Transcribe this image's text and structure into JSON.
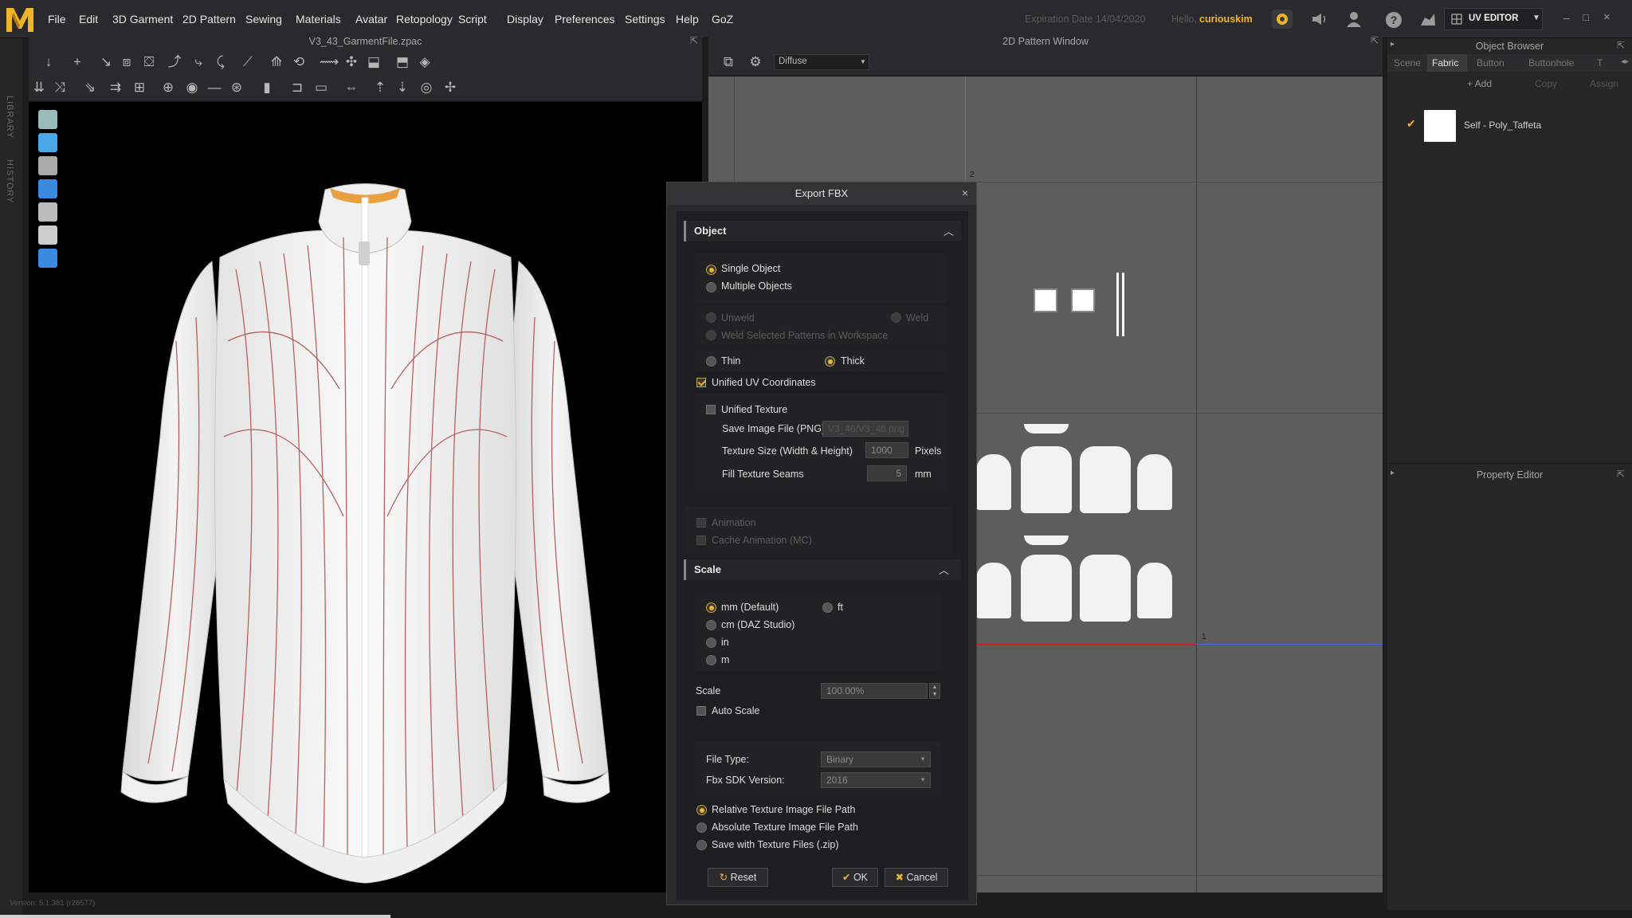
{
  "menubar": {
    "logo_letter": "M",
    "items": [
      "File",
      "Edit",
      "3D Garment",
      "2D Pattern",
      "Sewing",
      "Materials",
      "Avatar",
      "Retopology",
      "Script",
      "Display",
      "Preferences",
      "Settings",
      "Help",
      "GoZ"
    ],
    "expiration_label": "Expiration Date 14/04/2020",
    "hello_label": "Hello,",
    "username": "curiouskim",
    "mode": "UV EDITOR"
  },
  "left_tabs": [
    "LIBRARY",
    "HISTORY"
  ],
  "viewport3d": {
    "title": "V3_43_GarmentFile.zpac",
    "version": "Version: 5.1.381 (r28577)"
  },
  "pattern_window": {
    "title": "2D Pattern Window",
    "render_mode": "Diffuse",
    "marker_top": "2",
    "marker_bottom": "1"
  },
  "object_browser": {
    "title": "Object Browser",
    "tabs": [
      "Scene",
      "Fabric",
      "Button",
      "Buttonhole",
      "T"
    ],
    "active_tab": "Fabric",
    "actions": [
      "+ Add",
      "Copy",
      "Assign"
    ],
    "fabric_item": "Self - Poly_Taffeta"
  },
  "property_editor": {
    "title": "Property Editor"
  },
  "dialog": {
    "title": "Export FBX",
    "close_icon": "×",
    "object_section": "Object",
    "single_object": "Single Object",
    "multiple_objects": "Multiple Objects",
    "unweld": "Unweld",
    "weld": "Weld",
    "weld_selected": "Weld Selected Patterns in Workspace",
    "thin": "Thin",
    "thick": "Thick",
    "unified_uv": "Unified UV Coordinates",
    "unified_texture": "Unified Texture",
    "save_image_label": "Save Image File (PNG)",
    "save_image_value": "V3_46/V3_46.png",
    "texture_size_label": "Texture Size (Width & Height)",
    "texture_size_value": "1000",
    "texture_size_unit": "Pixels",
    "fill_seams_label": "Fill Texture Seams",
    "fill_seams_value": "5",
    "fill_seams_unit": "mm",
    "animation": "Animation",
    "cache_animation": "Cache Animation (MC)",
    "scale_section": "Scale",
    "unit_mm": "mm (Default)",
    "unit_ft": "ft",
    "unit_cm": "cm (DAZ Studio)",
    "unit_in": "in",
    "unit_m": "m",
    "scale_label": "Scale",
    "scale_value": "100.00%",
    "auto_scale": "Auto Scale",
    "file_type_label": "File Type:",
    "file_type_value": "Binary",
    "sdk_label": "Fbx SDK Version:",
    "sdk_value": "2016",
    "relative_path": "Relative Texture Image File Path",
    "absolute_path": "Absolute Texture Image File Path",
    "save_zip": "Save with Texture Files (.zip)",
    "reset": "Reset",
    "ok": "OK",
    "cancel": "Cancel"
  },
  "colors": {
    "accent": "#f0b429",
    "selected_tab": "#3b3b3d"
  }
}
